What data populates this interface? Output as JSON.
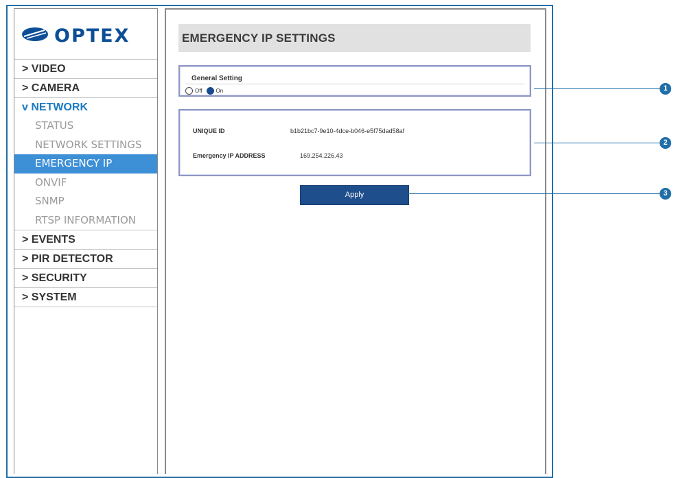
{
  "brand": {
    "logo_text": "OPTEX"
  },
  "sidebar": {
    "menu": [
      {
        "label": "> VIDEO"
      },
      {
        "label": "> CAMERA"
      },
      {
        "label": "v NETWORK"
      }
    ],
    "network_items": [
      {
        "label": "STATUS"
      },
      {
        "label": "NETWORK SETTINGS"
      },
      {
        "label": "EMERGENCY IP"
      },
      {
        "label": "ONVIF"
      },
      {
        "label": "SNMP"
      },
      {
        "label": "RTSP INFORMATION"
      }
    ],
    "menu_after": [
      {
        "label": "> EVENTS"
      },
      {
        "label": "> PIR DETECTOR"
      },
      {
        "label": "> SECURITY"
      },
      {
        "label": "> SYSTEM"
      }
    ],
    "active_item": "EMERGENCY IP"
  },
  "main": {
    "title": "EMERGENCY IP SETTINGS",
    "general_setting": {
      "label": "General Setting",
      "options": [
        {
          "label": "Off",
          "selected": false
        },
        {
          "label": "On",
          "selected": true
        }
      ]
    },
    "info": {
      "unique_id_label": "UNIQUE ID",
      "unique_id_value": "b1b21bc7-9e10-4dce-b046-e5f75dad58af",
      "emergency_ip_label": "Emergency IP ADDRESS",
      "emergency_ip_value": "169.254.226.43"
    },
    "apply_label": "Apply"
  },
  "callouts": [
    "1",
    "2",
    "3"
  ],
  "colors": {
    "accent": "#1f6ea8",
    "active_bg": "#3d8fd6",
    "button_bg": "#1f4e8c",
    "open_menu": "#1a7bc1"
  }
}
